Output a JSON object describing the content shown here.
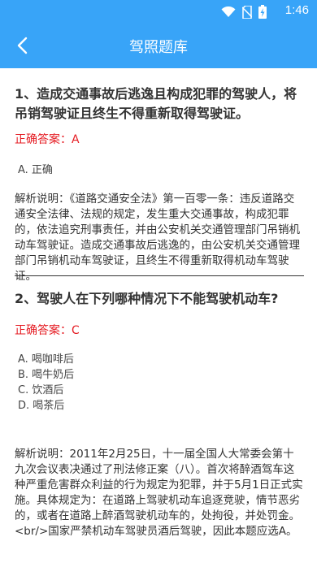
{
  "status_bar": {
    "time": "1:46"
  },
  "app_bar": {
    "title": "驾照题库"
  },
  "questions": [
    {
      "question": "1、造成交通事故后逃逸且构成犯罪的驾驶人，将吊销驾驶证且终生不得重新取得驾驶证。",
      "answer": "正确答案：A",
      "options": [
        "A. 正确"
      ],
      "explanation": "解析说明：《道路交通安全法》第一百零一条：违反道路交通安全法律、法规的规定，发生重大交通事故，构成犯罪的，依法追究刑事责任，并由公安机关交通管理部门吊销机动车驾驶证。造成交通事故后逃逸的，由公安机关交通管理部门吊销机动车驾驶证，且终生不得重新取得机动车驾驶证。"
    },
    {
      "question": "2、驾驶人在下列哪种情况下不能驾驶机动车?",
      "answer": "正确答案：C",
      "options": [
        "A. 喝咖啡后",
        "B. 喝牛奶后",
        "C. 饮酒后",
        "D. 喝茶后"
      ],
      "explanation": "解析说明：2011年2月25日，十一届全国人大常委会第十九次会议表决通过了刑法修正案（八）。首次将醉酒驾车这种严重危害群众利益的行为规定为犯罪，并于5月1日正式实施。具体规定为：在道路上驾驶机动车追逐竞驶，情节恶劣的，或者在道路上醉酒驾驶机动车的，处拘役，并处罚金。 <br/>国家严禁机动车驾驶员酒后驾驶，因此本题应选A。"
    }
  ],
  "colors": {
    "primary": "#38a4f8",
    "answer": "#e51c23"
  },
  "icons": {
    "back": "chevron-left-icon",
    "wifi": "wifi-icon",
    "sim": "no-sim-icon",
    "battery": "battery-charging-icon"
  }
}
